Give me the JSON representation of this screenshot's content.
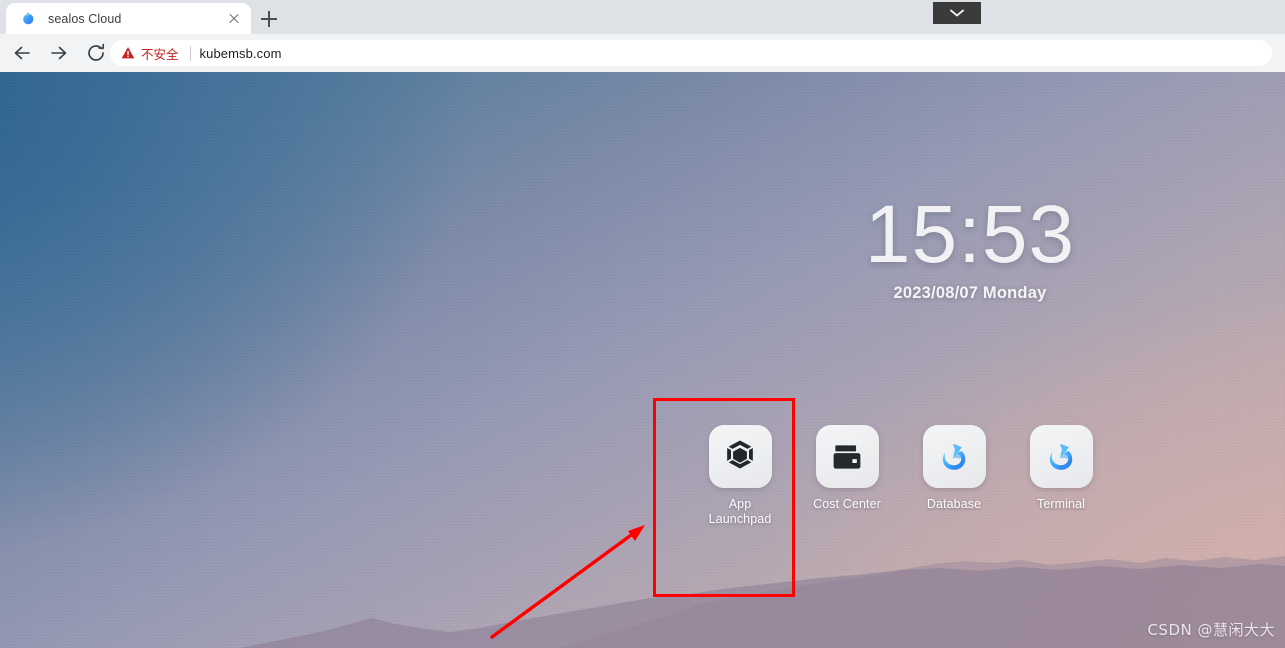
{
  "browser": {
    "tab": {
      "title": "sealos Cloud",
      "favicon_icon": "sealos-logo-icon",
      "close_icon": "close-icon"
    },
    "new_tab_icon": "plus-icon",
    "overlay_chevron_icon": "chevron-down-icon",
    "toolbar": {
      "back_icon": "arrow-left-icon",
      "forward_icon": "arrow-right-icon",
      "reload_icon": "reload-icon",
      "omnibox": {
        "warning_icon": "warning-triangle-icon",
        "warning_text": "不安全",
        "url": "kubemsb.com",
        "warning_color": "#c5221f"
      }
    }
  },
  "desktop": {
    "clock": {
      "time": "15:53",
      "date": "2023/08/07 Monday"
    },
    "apps": [
      {
        "label": "App\nLaunchpad",
        "label_line1": "App",
        "label_line2": "Launchpad",
        "icon": "hexagon-cube-icon"
      },
      {
        "label": "Cost Center",
        "label_line1": "Cost Center",
        "label_line2": "",
        "icon": "wallet-icon"
      },
      {
        "label": "Database",
        "label_line1": "Database",
        "label_line2": "",
        "icon": "sealos-logo-icon"
      },
      {
        "label": "Terminal",
        "label_line1": "Terminal",
        "label_line2": "",
        "icon": "sealos-logo-icon"
      }
    ],
    "annotations": {
      "highlight_rect_color": "#fe0000",
      "arrow_color": "#fe0000",
      "arrow_icon": "arrow-pointer-icon"
    },
    "watermark": "CSDN @慧闲大大",
    "background": {
      "top_left_color": "#3f6d95",
      "top_right_color": "#9ca0b8",
      "bottom_left_color": "#9aa0bb",
      "bottom_right_color": "#c5aeae"
    }
  }
}
